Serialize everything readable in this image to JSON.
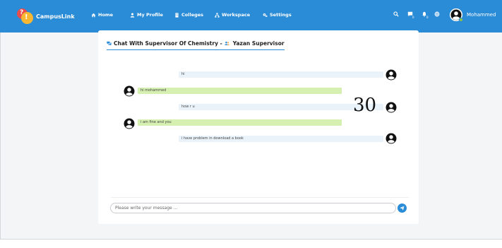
{
  "brand": {
    "name": "CampusLink",
    "logo_marks": [
      "?",
      "!"
    ]
  },
  "nav": {
    "items": [
      {
        "label": "Home",
        "icon": "home-icon"
      },
      {
        "label": "My Profile",
        "icon": "user-icon"
      },
      {
        "label": "Colleges",
        "icon": "building-icon"
      },
      {
        "label": "Workspace",
        "icon": "sitemap-icon"
      },
      {
        "label": "Settings",
        "icon": "gears-icon"
      }
    ],
    "search_icon": "search-icon",
    "messages": {
      "icon": "chat-icon",
      "count": "0"
    },
    "notifications": {
      "icon": "bell-icon",
      "count": "0"
    },
    "language_icon": "globe-icon",
    "user": {
      "name": "Mohammed",
      "status": "online"
    }
  },
  "chat": {
    "title_prefix": "Chat With Supervisor Of Chemistry -",
    "supervisor": "Yazan Supervisor",
    "messages": [
      {
        "text": "hi",
        "side": "right",
        "sender": "supervisor"
      },
      {
        "text": "hi mohammed",
        "side": "left",
        "sender": "self"
      },
      {
        "text": "how r u",
        "side": "right",
        "sender": "supervisor"
      },
      {
        "text": "i am fine and you",
        "side": "left",
        "sender": "self"
      },
      {
        "text": "i have problem in download a book",
        "side": "right",
        "sender": "supervisor"
      }
    ],
    "overlay_number": "30",
    "input": {
      "placeholder": "Please write your message ...",
      "value": ""
    },
    "send_icon": "send-icon"
  },
  "colors": {
    "primary": "#2a8bd6",
    "incoming_bubble": "#eaf3fa",
    "outgoing_bubble": "#d6f0b2",
    "online": "#8bc34a"
  }
}
